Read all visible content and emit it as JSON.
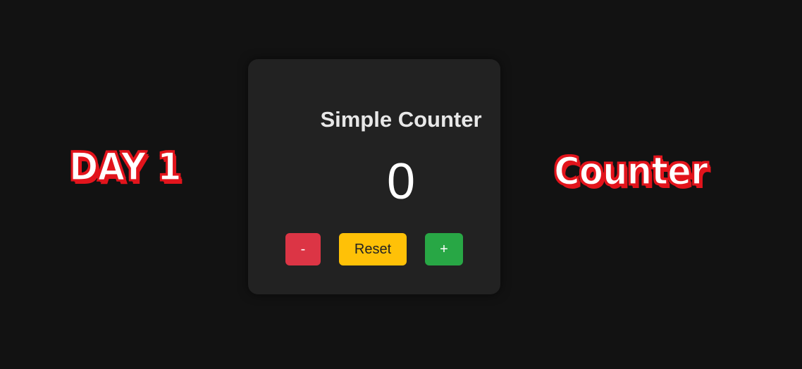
{
  "side_labels": {
    "left": "DAY 1",
    "right": "Counter"
  },
  "counter": {
    "title": "Simple Counter",
    "value": "0",
    "buttons": {
      "decrement": "-",
      "reset": "Reset",
      "increment": "+"
    }
  },
  "colors": {
    "background": "#121212",
    "card": "#222222",
    "decrement": "#dc3545",
    "reset": "#ffc107",
    "increment": "#28a745",
    "label_outline": "#e2141c"
  }
}
